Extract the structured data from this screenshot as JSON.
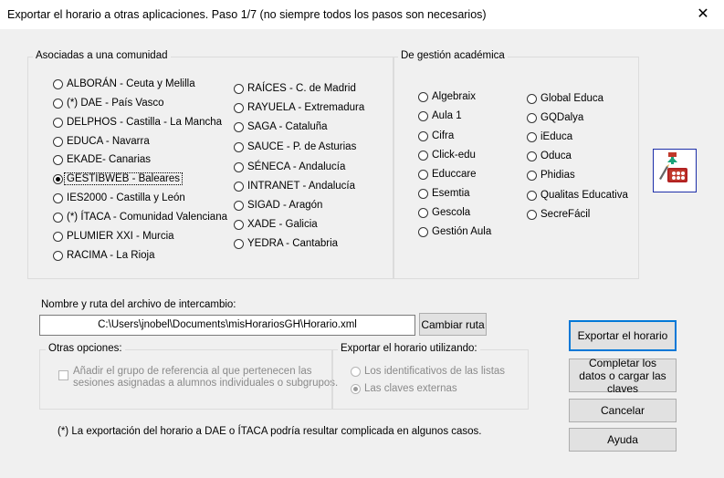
{
  "window": {
    "title": "Exportar el horario a otras aplicaciones.  Paso 1/7 (no siempre todos los pasos son necesarios)",
    "close_glyph": "✕"
  },
  "groups": {
    "comunidad": {
      "title": "Asociadas a una comunidad"
    },
    "gestion": {
      "title": "De gestión académica"
    }
  },
  "comunidad_col1": [
    "ALBORÁN - Ceuta y Melilla",
    "(*) DAE - País Vasco",
    "DELPHOS - Castilla - La Mancha",
    "EDUCA - Navarra",
    "EKADE- Canarias",
    "GESTIBWEB - Baleares",
    "IES2000 - Castilla y León",
    "(*) ÍTACA - Comunidad Valenciana",
    "PLUMIER XXI - Murcia",
    "RACIMA - La Rioja"
  ],
  "comunidad_col2": [
    "RAÍCES - C. de Madrid",
    "RAYUELA - Extremadura",
    "SAGA - Cataluña",
    "SAUCE - P. de Asturias",
    "SÉNECA - Andalucía",
    "INTRANET - Andalucía",
    "SIGAD - Aragón",
    "XADE - Galicia",
    "YEDRA - Cantabria"
  ],
  "gestion_col1": [
    "Algebraix",
    "Aula 1",
    "Cifra",
    "Click-edu",
    "Educcare",
    "Esemtia",
    "Gescola",
    "Gestión Aula"
  ],
  "gestion_col2": [
    "Global Educa",
    "GQDalya",
    "iEduca",
    "Oduca",
    "Phidias",
    "Qualitas Educativa",
    "SecreFácil"
  ],
  "selected": "GESTIBWEB - Baleares",
  "file": {
    "label": "Nombre y ruta del archivo de intercambio:",
    "value": "C:\\Users\\jnobel\\Documents\\misHorariosGH\\Horario.xml",
    "change_button": "Cambiar ruta"
  },
  "otras": {
    "title": "Otras opciones:",
    "checkbox_label_line1": "Añadir el grupo de referencia al que pertenecen las",
    "checkbox_label_line2": "sesiones asignadas a alumnos individuales o subgrupos."
  },
  "exportar_utilizando": {
    "title": "Exportar el horario utilizando:",
    "opt1": "Los identificativos de las listas",
    "opt2": "Las claves externas"
  },
  "note": "(*) La exportación del horario a DAE o ÍTACA podría resultar complicada en algunos casos.",
  "buttons": {
    "export": "Exportar el horario",
    "complete": "Completar los datos o cargar las claves",
    "cancel": "Cancelar",
    "help": "Ayuda"
  },
  "colors": {
    "accent": "#0078d7",
    "icon_red": "#c0392b",
    "icon_green": "#1aa37a"
  }
}
